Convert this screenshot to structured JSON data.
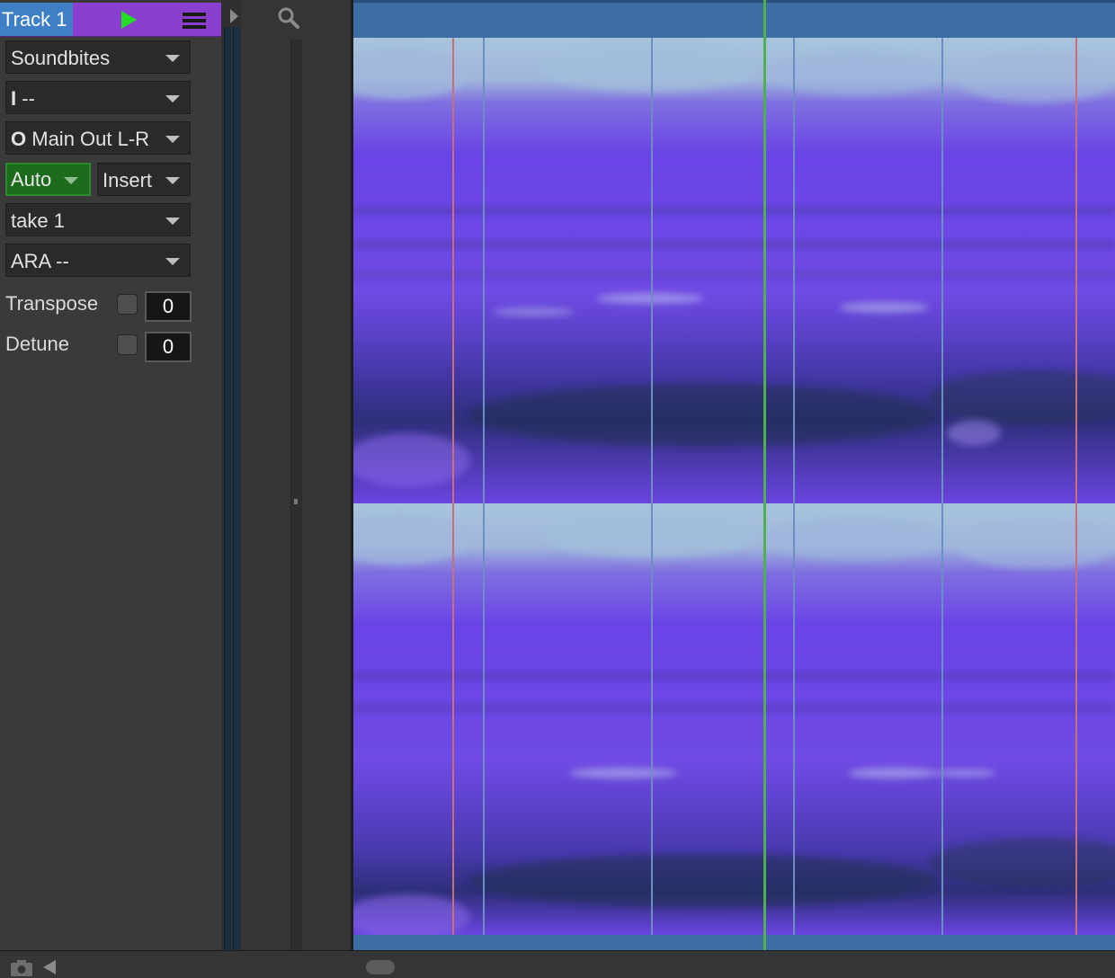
{
  "track": {
    "name": "Track 1"
  },
  "inspector": {
    "category": "Soundbites",
    "input_prefix": "I",
    "input_value": "--",
    "output_prefix": "O",
    "output_value": "Main Out L-R",
    "automation_mode": "Auto",
    "insert_mode": "Insert",
    "take": "take 1",
    "ara": "ARA --",
    "transpose_label": "Transpose",
    "transpose_value": "0",
    "detune_label": "Detune",
    "detune_value": "0"
  },
  "icons": {
    "play": "play-icon",
    "menu": "hamburger-menu-icon",
    "search": "search-icon",
    "expand": "expand-arrow-icon",
    "camera": "camera-icon",
    "left_arrow": "left-arrow-icon"
  },
  "colors": {
    "track_header": "#8a3fd0",
    "track_name_bg": "#3f7fc6",
    "play_icon": "#22dd22",
    "auto_mode_bg": "#1d6b1d",
    "ruler": "#3d6ea3",
    "playhead": "#4fb04f",
    "marker_red": "#c8707a",
    "marker_blue": "#6a8fc0",
    "spectrogram_base": "#6a3fe0",
    "spectrogram_high": "#a8c4dc"
  }
}
